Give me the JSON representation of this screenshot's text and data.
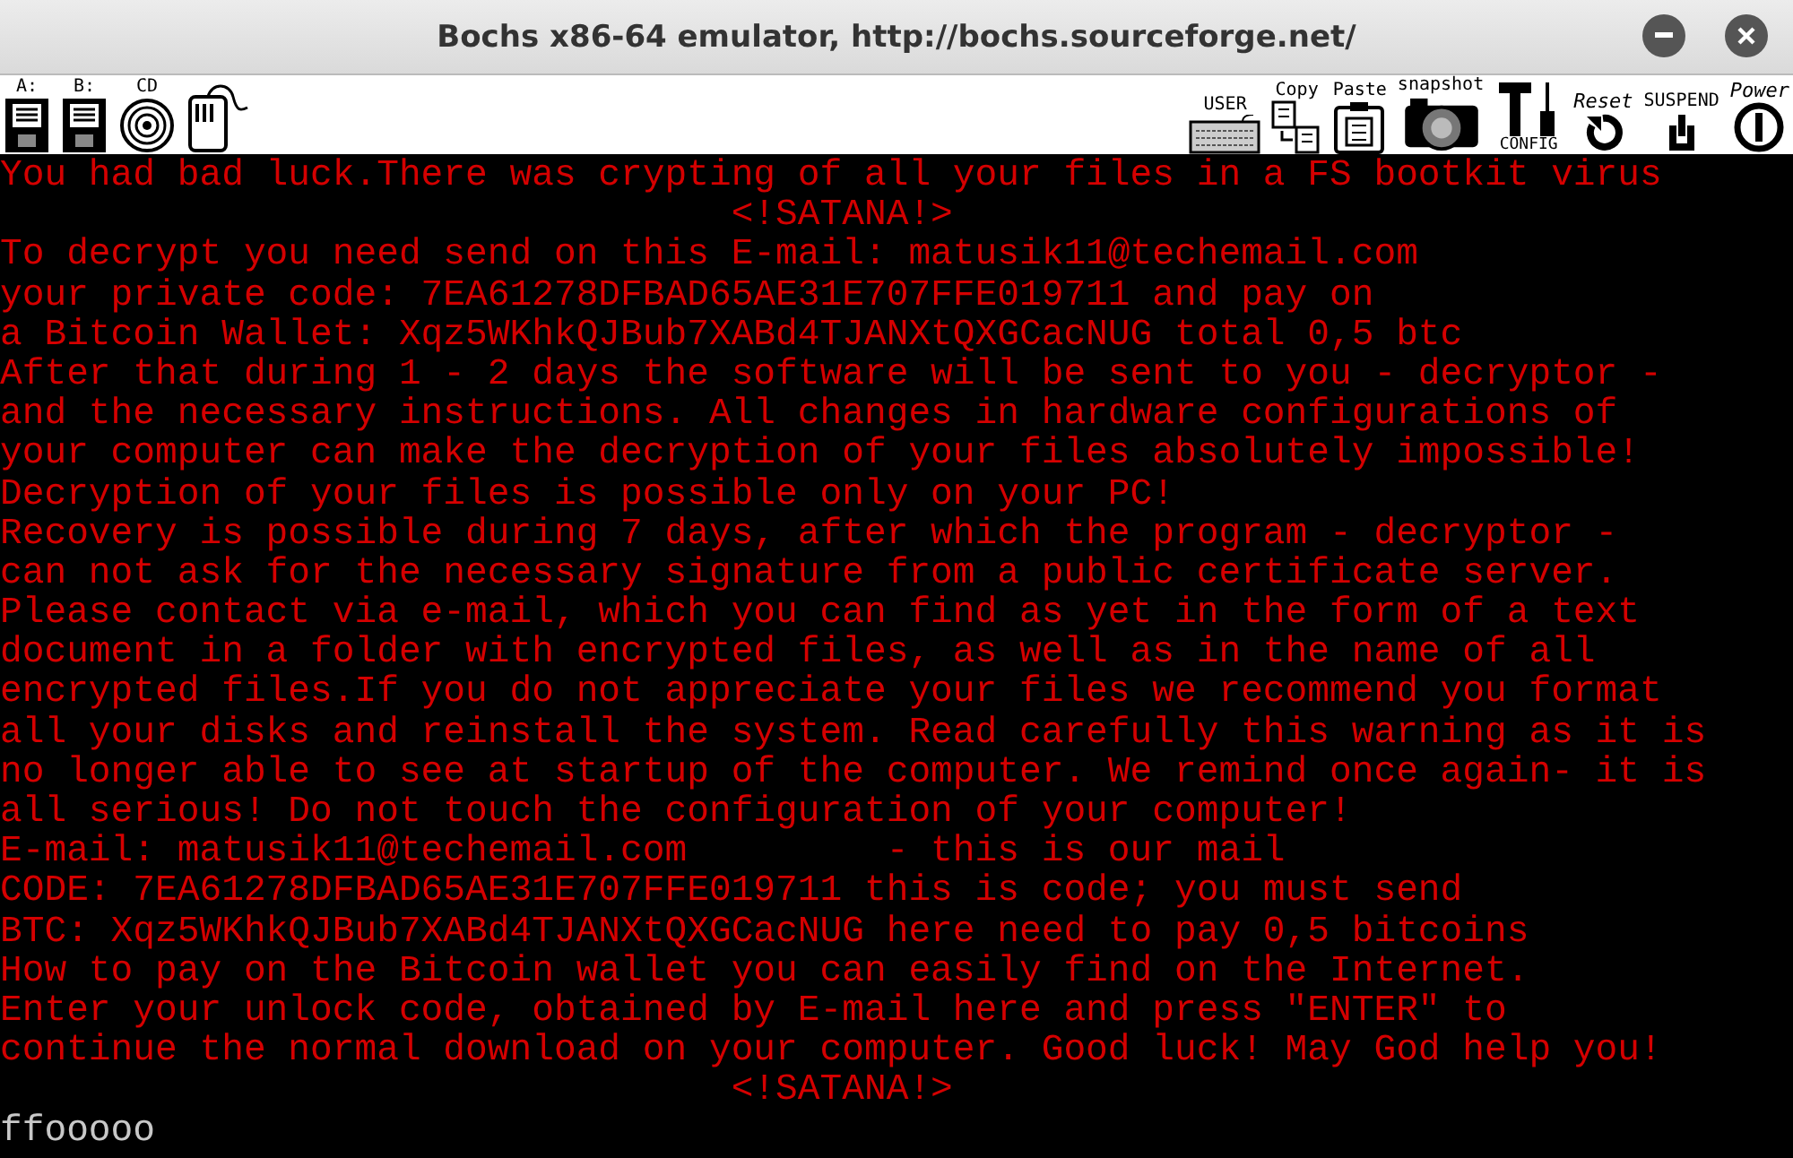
{
  "window": {
    "title": "Bochs x86-64 emulator, http://bochs.sourceforge.net/"
  },
  "toolbar_left": [
    {
      "label": "A:",
      "kind": "floppy"
    },
    {
      "label": "B:",
      "kind": "floppy"
    },
    {
      "label": "CD",
      "kind": "cdrom"
    },
    {
      "kind": "mouse"
    }
  ],
  "toolbar_right": [
    {
      "label": "USER",
      "kind": "keyboard"
    },
    {
      "label": "Copy",
      "kind": "copy"
    },
    {
      "label": "Paste",
      "kind": "paste"
    },
    {
      "label": "snapshot",
      "kind": "camera"
    },
    {
      "label": "CONFIG",
      "kind": "config"
    },
    {
      "label": "Reset",
      "kind": "reset"
    },
    {
      "label": "SUSPEND",
      "kind": "suspend"
    },
    {
      "label": "Power",
      "kind": "power"
    }
  ],
  "console": {
    "lines": [
      {
        "kind": "output",
        "text": "You had bad luck.There was crypting of all your files in a FS bootkit virus"
      },
      {
        "kind": "output",
        "text": "                                 <!SATANA!>"
      },
      {
        "kind": "output",
        "text": "To decrypt you need send on this E-mail: matusik11@techemail.com"
      },
      {
        "kind": "output",
        "text": "your private code: 7EA61278DFBAD65AE31E707FFE019711 and pay on"
      },
      {
        "kind": "output",
        "text": "a Bitcoin Wallet: Xqz5WKhkQJBub7XABd4TJANXtQXGCacNUG total 0,5 btc"
      },
      {
        "kind": "output",
        "text": "After that during 1 - 2 days the software will be sent to you - decryptor -"
      },
      {
        "kind": "output",
        "text": "and the necessary instructions. All changes in hardware configurations of"
      },
      {
        "kind": "output",
        "text": "your computer can make the decryption of your files absolutely impossible!"
      },
      {
        "kind": "output",
        "text": "Decryption of your files is possible only on your PC!"
      },
      {
        "kind": "output",
        "text": "Recovery is possible during 7 days, after which the program - decryptor -"
      },
      {
        "kind": "output",
        "text": "can not ask for the necessary signature from a public certificate server."
      },
      {
        "kind": "output",
        "text": "Please contact via e-mail, which you can find as yet in the form of a text"
      },
      {
        "kind": "output",
        "text": "document in a folder with encrypted files, as well as in the name of all"
      },
      {
        "kind": "output",
        "text": "encrypted files.If you do not appreciate your files we recommend you format"
      },
      {
        "kind": "output",
        "text": "all your disks and reinstall the system. Read carefully this warning as it is"
      },
      {
        "kind": "output",
        "text": "no longer able to see at startup of the computer. We remind once again- it is"
      },
      {
        "kind": "output",
        "text": "all serious! Do not touch the configuration of your computer!"
      },
      {
        "kind": "output",
        "text": "E-mail: matusik11@techemail.com         - this is our mail"
      },
      {
        "kind": "output",
        "text": "CODE: 7EA61278DFBAD65AE31E707FFE019711 this is code; you must send"
      },
      {
        "kind": "output",
        "text": "BTC: Xqz5WKhkQJBub7XABd4TJANXtQXGCacNUG here need to pay 0,5 bitcoins"
      },
      {
        "kind": "output",
        "text": "How to pay on the Bitcoin wallet you can easily find on the Internet."
      },
      {
        "kind": "output",
        "text": "Enter your unlock code, obtained by E-mail here and press \"ENTER\" to"
      },
      {
        "kind": "output",
        "text": "continue the normal download on your computer. Good luck! May God help you!"
      },
      {
        "kind": "output",
        "text": "                                 <!SATANA!>"
      },
      {
        "kind": "input",
        "text": "ffooooo"
      }
    ]
  }
}
